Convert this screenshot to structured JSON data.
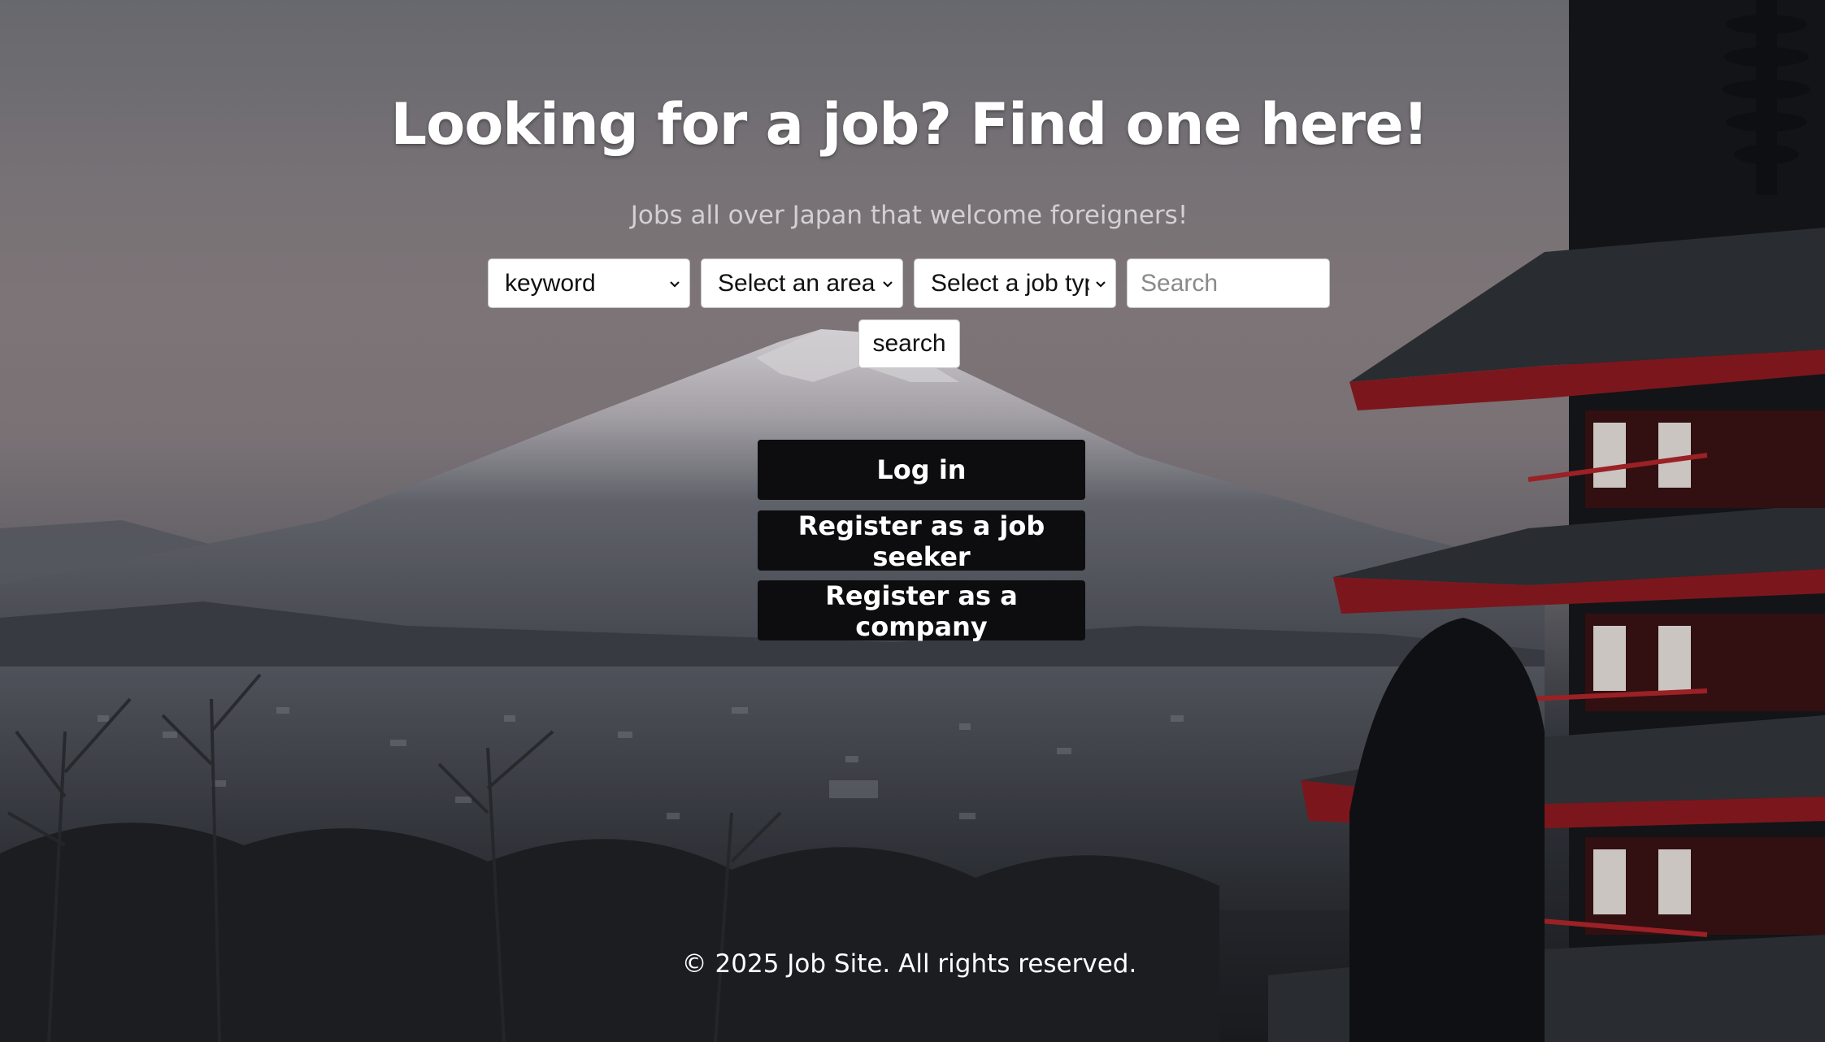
{
  "hero": {
    "title": "Looking for a job? Find one here!",
    "subtitle": "Jobs all over Japan that welcome foreigners!"
  },
  "search": {
    "keyword_select": "keyword",
    "area_select": "Select an area",
    "job_type_select": "Select a job type",
    "search_placeholder": "Search",
    "search_button": "search"
  },
  "actions": {
    "login": "Log in",
    "register_seeker": "Register as a job seeker",
    "register_company": "Register as a company"
  },
  "footer": {
    "copyright": "© 2025 Job Site. All rights reserved."
  },
  "colors": {
    "action_button_bg": "#0d0d0f",
    "title_text": "#ffffff",
    "subtitle_text": "#d4d0d2"
  },
  "background": "mount-fuji-pagoda-photo"
}
